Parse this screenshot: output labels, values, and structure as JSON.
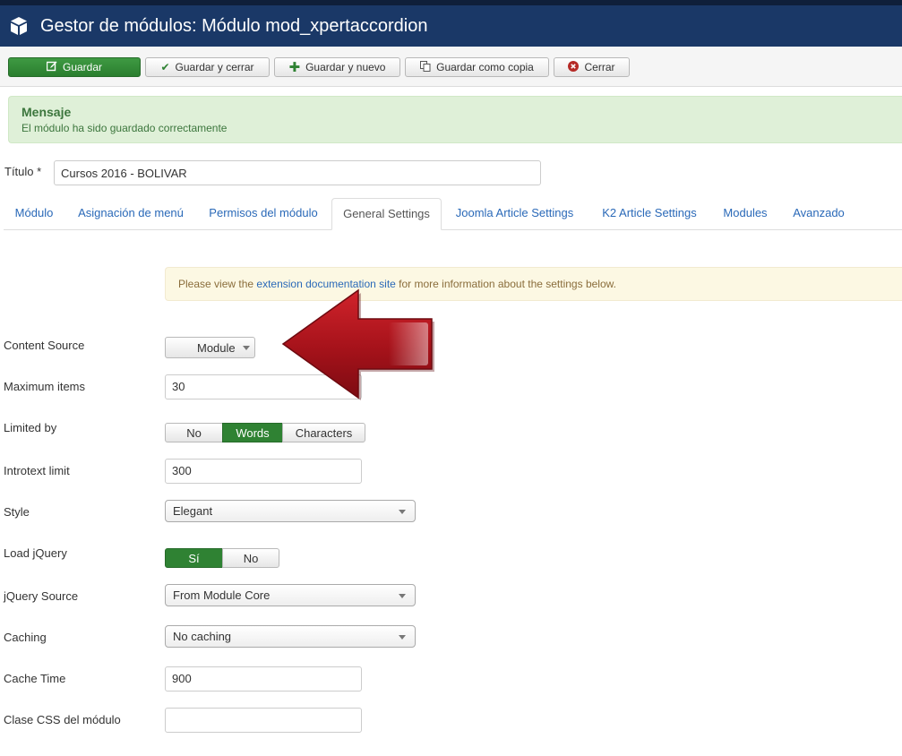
{
  "header": {
    "title": "Gestor de módulos: Módulo mod_xpertaccordion",
    "icon": "cube-icon"
  },
  "toolbar": {
    "save": "Guardar",
    "save_close": "Guardar y cerrar",
    "save_new": "Guardar y nuevo",
    "save_copy": "Guardar como copia",
    "close": "Cerrar"
  },
  "message": {
    "heading": "Mensaje",
    "text": "El módulo ha sido guardado correctamente"
  },
  "title_field": {
    "label": "Título *",
    "value": "Cursos 2016 - BOLIVAR"
  },
  "tabs": [
    {
      "label": "Módulo"
    },
    {
      "label": "Asignación de menú"
    },
    {
      "label": "Permisos del módulo"
    },
    {
      "label": "General Settings"
    },
    {
      "label": "Joomla Article Settings"
    },
    {
      "label": "K2 Article Settings"
    },
    {
      "label": "Modules"
    },
    {
      "label": "Avanzado"
    }
  ],
  "active_tab": "General Settings",
  "info": {
    "before": "Please view the ",
    "link": "extension documentation site",
    "after": " for more information about the settings below."
  },
  "fields": {
    "content_source": {
      "label": "Content Source",
      "value": "Module"
    },
    "max_items": {
      "label": "Maximum items",
      "value": "30"
    },
    "limited_by": {
      "label": "Limited by",
      "options": [
        "No",
        "Words",
        "Characters"
      ],
      "selected": "Words"
    },
    "introtext_limit": {
      "label": "Introtext limit",
      "value": "300"
    },
    "style": {
      "label": "Style",
      "value": "Elegant"
    },
    "load_jquery": {
      "label": "Load jQuery",
      "options": [
        "Sí",
        "No"
      ],
      "selected": "Sí"
    },
    "jquery_source": {
      "label": "jQuery Source",
      "value": "From Module Core"
    },
    "caching": {
      "label": "Caching",
      "value": "No caching"
    },
    "cache_time": {
      "label": "Cache Time",
      "value": "900"
    },
    "css_class": {
      "label": "Clase CSS del módulo",
      "value": ""
    }
  },
  "colors": {
    "header_bg": "#1a3867",
    "success": "#2f8233",
    "alert_success_bg": "#dff0d8",
    "alert_info_bg": "#fcf8e3",
    "link": "#2a69b8",
    "arrow": "#b3141c"
  }
}
